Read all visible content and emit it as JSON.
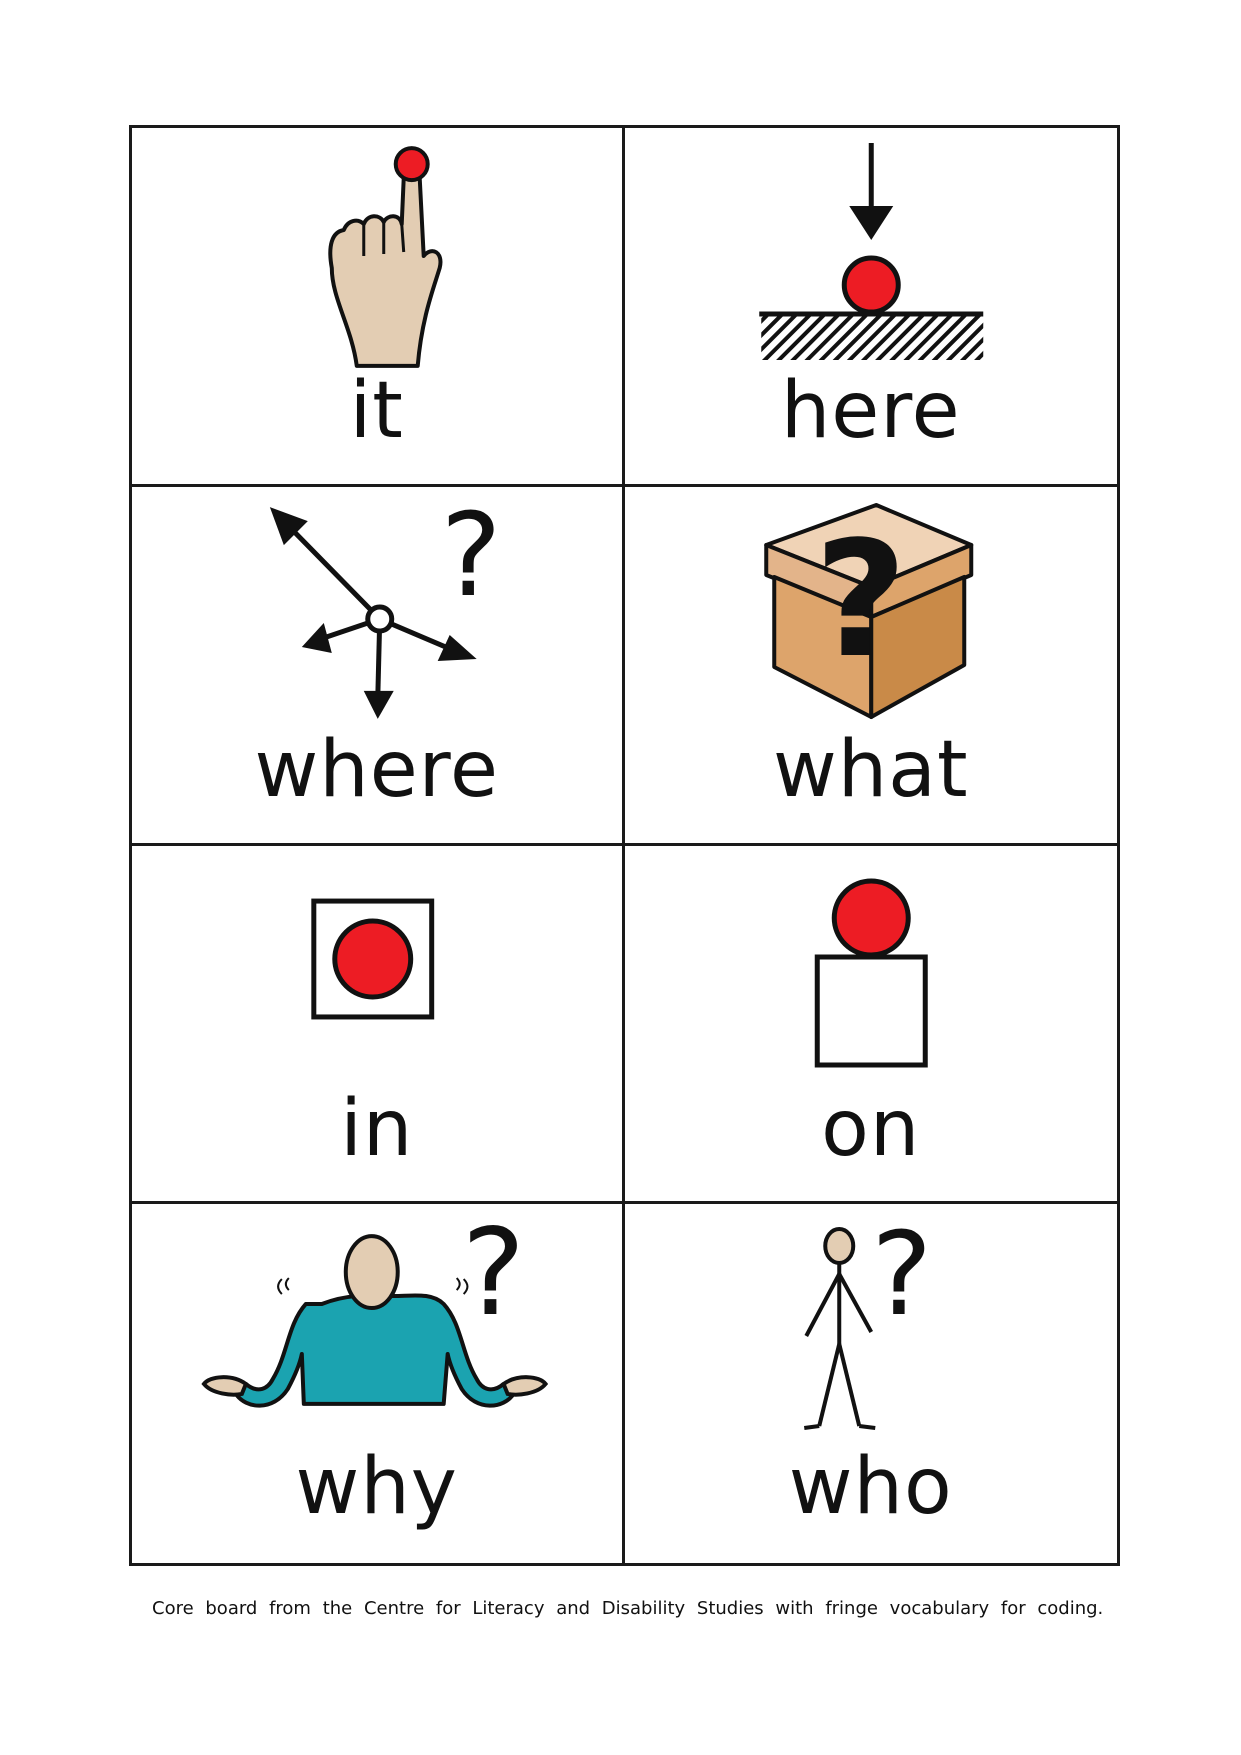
{
  "board": {
    "cells": [
      {
        "word": "it",
        "icon": "pointing-finger-icon"
      },
      {
        "word": "here",
        "icon": "arrow-down-to-ball-icon"
      },
      {
        "word": "where",
        "icon": "directions-question-icon"
      },
      {
        "word": "what",
        "icon": "question-box-icon"
      },
      {
        "word": "in",
        "icon": "ball-in-square-icon"
      },
      {
        "word": "on",
        "icon": "ball-on-box-icon"
      },
      {
        "word": "why",
        "icon": "shrugging-person-icon"
      },
      {
        "word": "who",
        "icon": "stick-person-question-icon"
      }
    ]
  },
  "footnote": "Core board from the Centre for Literacy and Disability Studies with fringe vocabulary for coding.",
  "colors": {
    "red": "#ED1C24",
    "skin": "#E3CDB3",
    "box_light": "#F0D3B6",
    "box_mid": "#DDA46B",
    "box_dark": "#C98A48",
    "teal": "#1BA3B0",
    "line": "#111111"
  }
}
